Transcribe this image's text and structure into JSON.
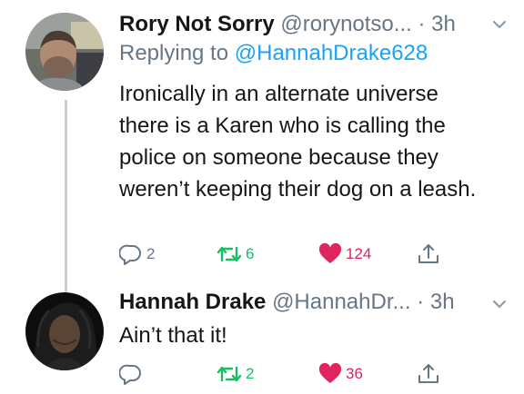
{
  "tweets": [
    {
      "name": "Rory Not Sorry",
      "handle": "@rorynotso...",
      "separator": "·",
      "time": "3h",
      "replying_prefix": "Replying to",
      "replying_to": "@HannahDrake628",
      "text": "Ironically in an alternate universe there is a Karen who is calling the police on someone because they weren’t keeping their dog on a leash.",
      "replies": "2",
      "retweets": "6",
      "likes": "124",
      "liked": true,
      "retweeted": true
    },
    {
      "name": "Hannah Drake",
      "handle": "@HannahDr...",
      "separator": "·",
      "time": "3h",
      "text": "Ain’t that it!",
      "replies": "",
      "retweets": "2",
      "likes": "36",
      "liked": true,
      "retweeted": true
    }
  ],
  "icons": {
    "reply": "speech-bubble-icon",
    "retweet": "retweet-arrows-icon",
    "like": "heart-icon",
    "share": "share-upload-icon",
    "menu": "chevron-down-icon"
  },
  "colors": {
    "link": "#1da1f2",
    "retweet": "#17bf63",
    "like": "#e0245e",
    "muted": "#657786"
  }
}
